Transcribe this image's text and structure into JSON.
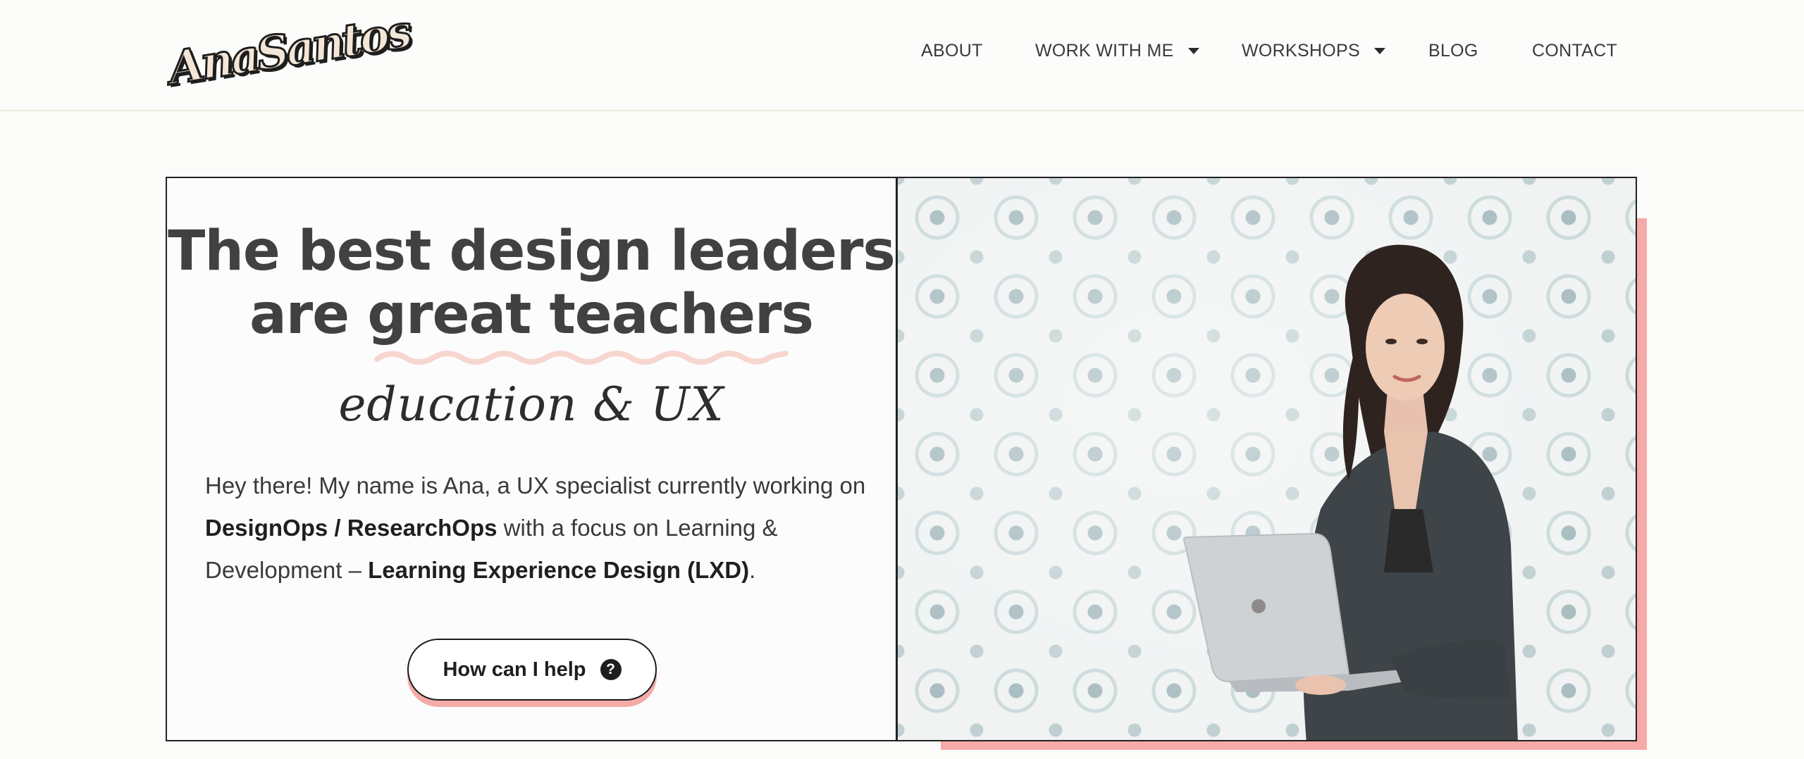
{
  "brand": {
    "logo_text": "AnaSantos"
  },
  "nav": {
    "items": [
      {
        "label": "ABOUT"
      },
      {
        "label": "WORK WITH ME"
      },
      {
        "label": "WORKSHOPS"
      },
      {
        "label": "BLOG"
      },
      {
        "label": "CONTACT"
      }
    ]
  },
  "hero": {
    "headline_line1": "The best design leaders",
    "headline_line2": "are great teachers",
    "script_tagline": "education & UX",
    "intro": {
      "part1": "Hey there! My name is Ana, a UX specialist currently working on ",
      "bold1": "DesignOps / ResearchOps",
      "part2": " with a focus on Learning & Development – ",
      "bold2": "Learning Experience Design (LXD)",
      "part3": "."
    },
    "cta_label": "How can I help",
    "cta_icon": "?"
  },
  "colors": {
    "accent_pink": "#f5aaa7",
    "text_dark": "#414141",
    "border": "#222222"
  },
  "icons": {
    "dropdown": "caret-down-icon",
    "help": "question-circle-icon"
  }
}
